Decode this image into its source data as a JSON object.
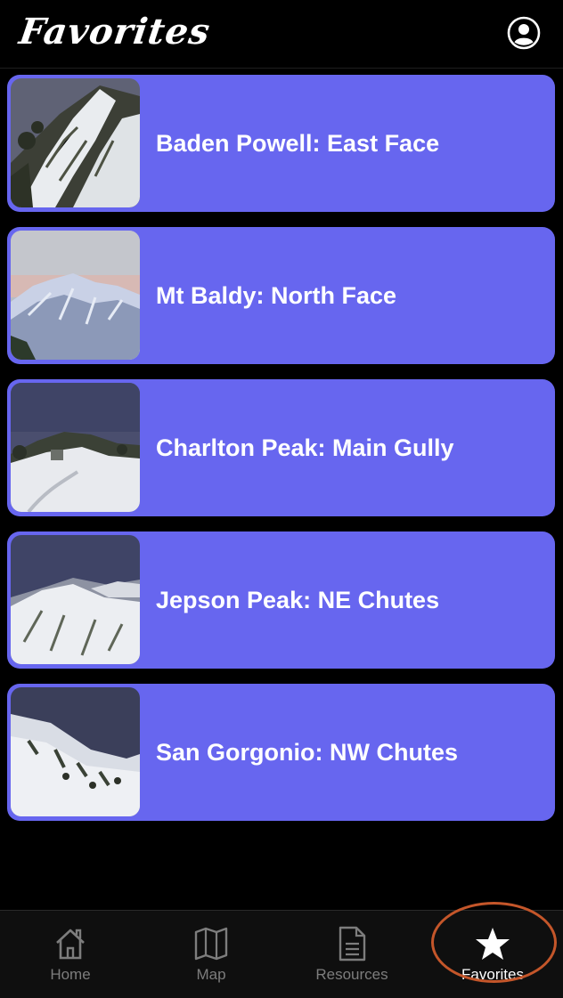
{
  "header": {
    "title": "Favorites",
    "profile_icon": "person-circle-icon"
  },
  "favorites": [
    {
      "label": "Baden Powell: East Face",
      "thumb": "snowy-ridge-photo"
    },
    {
      "label": "Mt Baldy: North Face",
      "thumb": "alpenglow-mountain-photo"
    },
    {
      "label": "Charlton Peak: Main Gully",
      "thumb": "snow-meadow-photo"
    },
    {
      "label": "Jepson Peak: NE Chutes",
      "thumb": "snowy-slope-photo"
    },
    {
      "label": "San Gorgonio: NW Chutes",
      "thumb": "snowy-bowl-photo"
    }
  ],
  "tabs": [
    {
      "label": "Home",
      "icon": "house-icon"
    },
    {
      "label": "Map",
      "icon": "map-icon"
    },
    {
      "label": "Resources",
      "icon": "document-icon"
    },
    {
      "label": "Favorites",
      "icon": "star-icon"
    }
  ],
  "colors": {
    "card": "#6766ef",
    "background": "#000000",
    "active_ring": "#c4562a"
  }
}
